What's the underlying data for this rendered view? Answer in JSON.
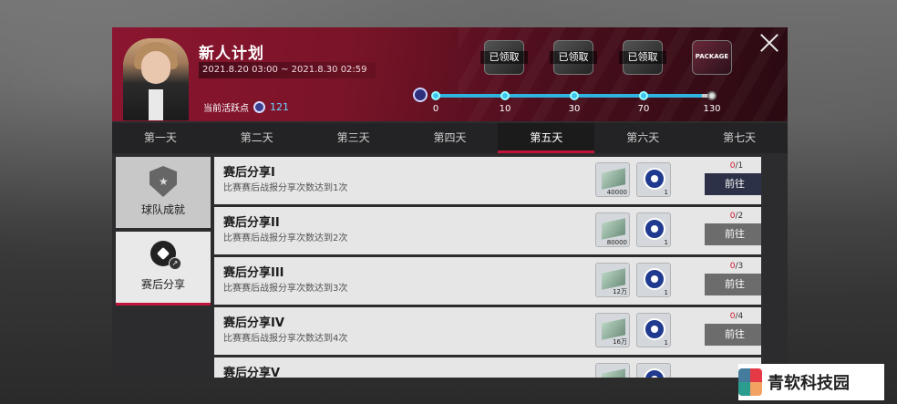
{
  "header": {
    "title": "新人计划",
    "date_range": "2021.8.20 03:00 ~ 2021.8.30 02:59",
    "activity_label": "当前活跃点",
    "activity_value": "121",
    "rewards": [
      {
        "label": "已领取"
      },
      {
        "label": "已领取"
      },
      {
        "label": "已领取"
      },
      {
        "label": "PACKAGE"
      }
    ],
    "progress": {
      "value": 121,
      "max": 130,
      "ticks": [
        "0",
        "10",
        "30",
        "70",
        "130"
      ]
    }
  },
  "tabs": [
    "第一天",
    "第二天",
    "第三天",
    "第四天",
    "第五天",
    "第六天",
    "第七天"
  ],
  "selected_tab": "第五天",
  "sidebar": [
    {
      "label": "球队成就"
    },
    {
      "label": "赛后分享"
    }
  ],
  "tasks": [
    {
      "name": "赛后分享I",
      "desc": "比赛赛后战报分享次数达到1次",
      "cash": "40000",
      "token": "1",
      "progress_cur": "0",
      "progress_total": "/1",
      "button": "前往"
    },
    {
      "name": "赛后分享II",
      "desc": "比赛赛后战报分享次数达到2次",
      "cash": "80000",
      "token": "1",
      "progress_cur": "0",
      "progress_total": "/2",
      "button": "前往"
    },
    {
      "name": "赛后分享III",
      "desc": "比赛赛后战报分享次数达到3次",
      "cash": "12万",
      "token": "1",
      "progress_cur": "0",
      "progress_total": "/3",
      "button": "前往"
    },
    {
      "name": "赛后分享IV",
      "desc": "比赛赛后战报分享次数达到4次",
      "cash": "16万",
      "token": "1",
      "progress_cur": "0",
      "progress_total": "/4",
      "button": "前往"
    },
    {
      "name": "赛后分享V",
      "desc": "",
      "cash": "",
      "token": "",
      "progress_cur": "",
      "progress_total": "",
      "button": ""
    }
  ],
  "watermark": {
    "text": "青软科技园"
  },
  "colors": {
    "accent": "#c0143a",
    "header_red": "#8b1530",
    "progress_blue": "#2fb4e0"
  }
}
